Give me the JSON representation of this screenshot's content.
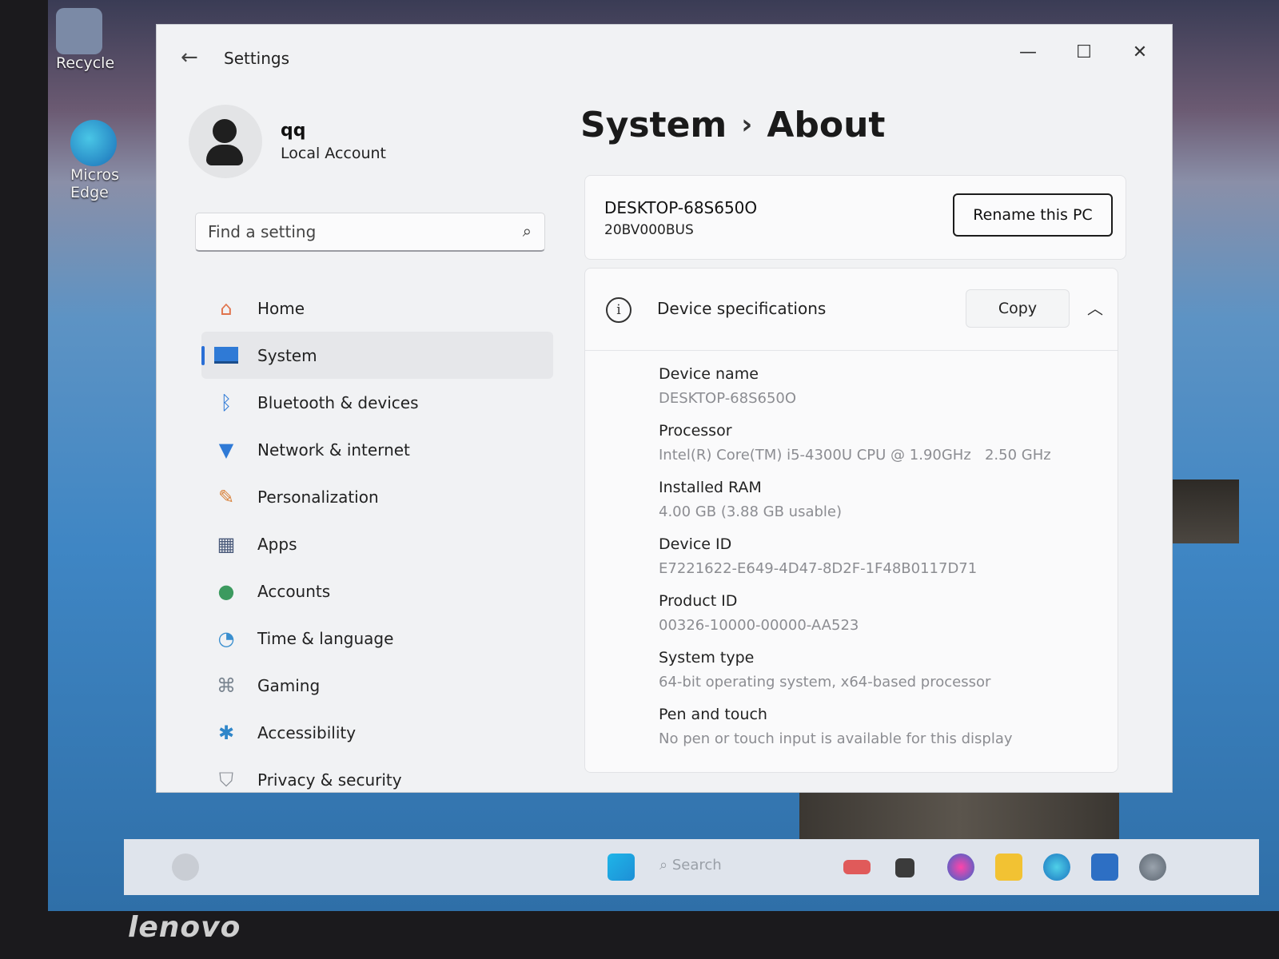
{
  "desktop": {
    "icons": [
      {
        "label": "Recycle",
        "name": "recycle-bin"
      },
      {
        "label": "Micros\nEdge",
        "name": "microsoft-edge"
      }
    ],
    "bezel_brand": "lenovo",
    "taskbar": {
      "search_placeholder": "Search"
    }
  },
  "window": {
    "title": "Settings",
    "controls": {
      "minimize": "—",
      "maximize": "☐",
      "close": "✕"
    }
  },
  "user": {
    "name": "qq",
    "account_type": "Local Account"
  },
  "search": {
    "placeholder": "Find a setting"
  },
  "nav": {
    "items": [
      {
        "label": "Home",
        "icon": "home-icon",
        "active": false
      },
      {
        "label": "System",
        "icon": "system-icon",
        "active": true
      },
      {
        "label": "Bluetooth & devices",
        "icon": "bluetooth-icon",
        "active": false
      },
      {
        "label": "Network & internet",
        "icon": "wifi-icon",
        "active": false
      },
      {
        "label": "Personalization",
        "icon": "brush-icon",
        "active": false
      },
      {
        "label": "Apps",
        "icon": "apps-icon",
        "active": false
      },
      {
        "label": "Accounts",
        "icon": "accounts-icon",
        "active": false
      },
      {
        "label": "Time & language",
        "icon": "globe-clock-icon",
        "active": false
      },
      {
        "label": "Gaming",
        "icon": "gamepad-icon",
        "active": false
      },
      {
        "label": "Accessibility",
        "icon": "accessibility-icon",
        "active": false
      },
      {
        "label": "Privacy & security",
        "icon": "shield-icon",
        "active": false
      }
    ]
  },
  "breadcrumb": {
    "parent": "System",
    "current": "About"
  },
  "pc": {
    "name": "DESKTOP-68S650O",
    "model": "20BV000BUS",
    "rename_label": "Rename this PC"
  },
  "specs": {
    "title": "Device specifications",
    "copy_label": "Copy",
    "rows": [
      {
        "key": "Device name",
        "value": "DESKTOP-68S650O"
      },
      {
        "key": "Processor",
        "value": "Intel(R) Core(TM) i5-4300U CPU @ 1.90GHz   2.50 GHz"
      },
      {
        "key": "Installed RAM",
        "value": "4.00 GB (3.88 GB usable)"
      },
      {
        "key": "Device ID",
        "value": "E7221622-E649-4D47-8D2F-1F48B0117D71"
      },
      {
        "key": "Product ID",
        "value": "00326-10000-00000-AA523"
      },
      {
        "key": "System type",
        "value": "64-bit operating system, x64-based processor"
      },
      {
        "key": "Pen and touch",
        "value": "No pen or touch input is available for this display"
      }
    ]
  },
  "colors": {
    "accent": "#2a6fd6",
    "window_bg": "#f1f2f4",
    "muted_text": "#8c8d92"
  }
}
